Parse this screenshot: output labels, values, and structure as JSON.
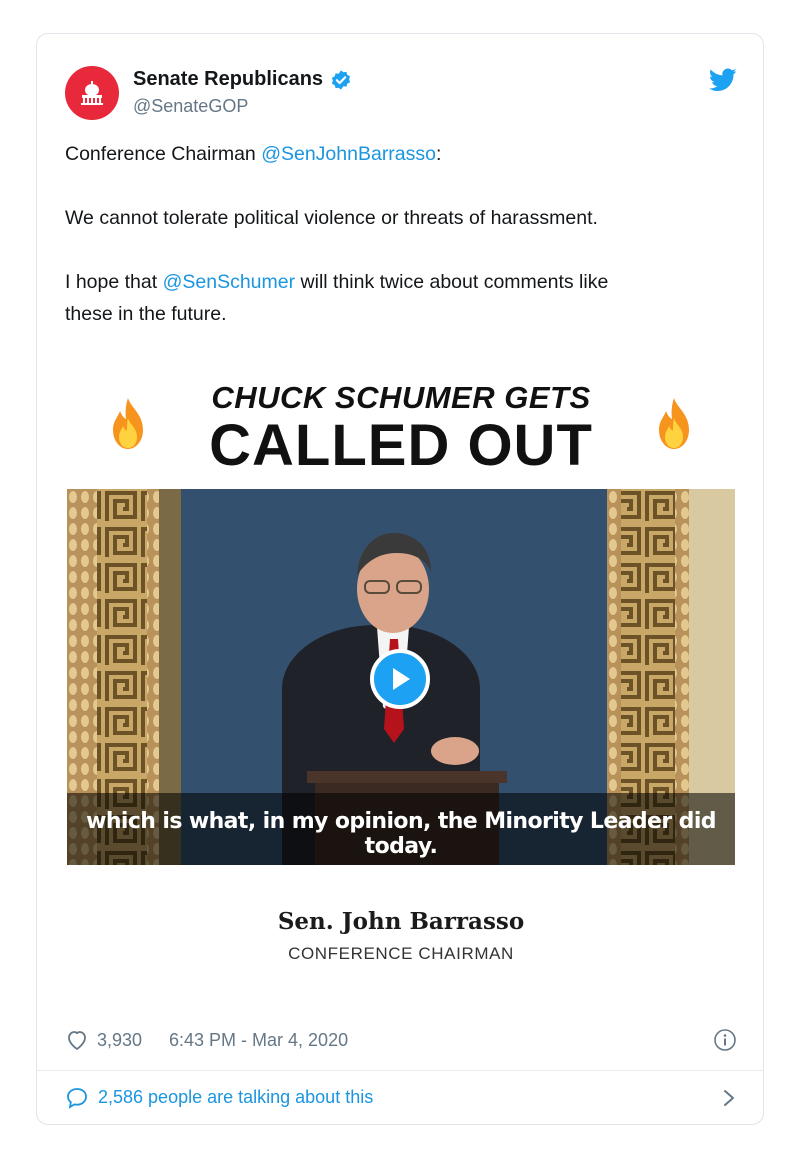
{
  "account": {
    "display_name": "Senate Republicans",
    "handle": "@SenateGOP"
  },
  "tweet": {
    "line1_prefix": "Conference Chairman ",
    "line1_mention": "@SenJohnBarrasso",
    "line1_suffix": ":",
    "line2": "We cannot tolerate political violence or threats of harassment.",
    "line3_prefix": "I hope that ",
    "line3_mention": "@SenSchumer",
    "line3_suffix": " will think twice about comments like",
    "line4": "these in the future."
  },
  "media": {
    "headline_top": "CHUCK SCHUMER GETS",
    "headline_main": "CALLED OUT",
    "caption": "which is what, in my opinion, the Minority Leader did today.",
    "speaker_name": "Sen. John Barrasso",
    "speaker_title": "CONFERENCE CHAIRMAN"
  },
  "meta": {
    "likes": "3,930",
    "timestamp": "6:43 PM - Mar 4, 2020"
  },
  "footer": {
    "talking": "2,586 people are talking about this"
  },
  "icons": {
    "avatar": "capitol-icon",
    "verified": "verified-badge-icon",
    "brand": "twitter-bird-icon",
    "like": "heart-icon",
    "info": "info-icon",
    "reply": "speech-bubble-icon",
    "expand": "chevron-right-icon"
  },
  "colors": {
    "link": "#1b95e0",
    "avatar_bg": "#e8283b",
    "verified": "#1da1f2",
    "muted": "#657786"
  }
}
